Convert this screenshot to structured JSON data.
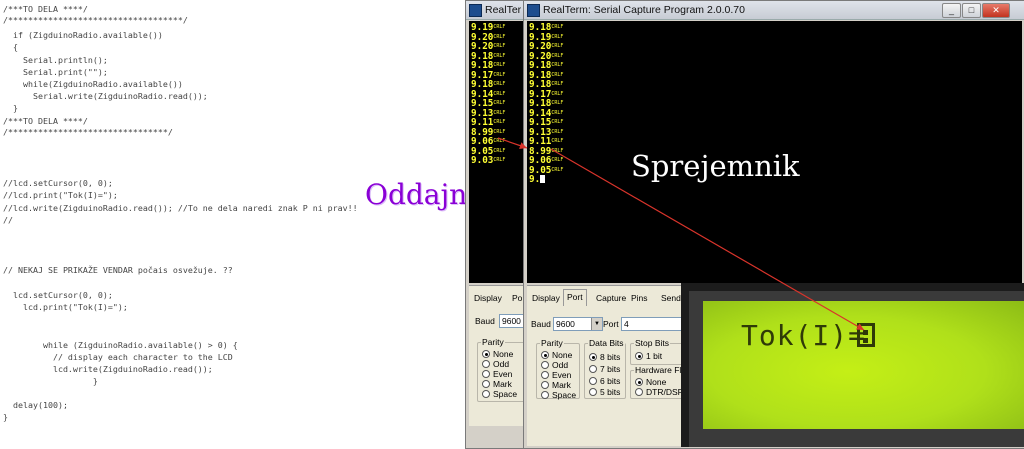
{
  "code": {
    "lines": [
      "/***TO DELA ****/",
      "/***********************************/",
      "  if (ZigduinoRadio.available())",
      "  {",
      "    Serial.println();",
      "    Serial.print(\"\");",
      "    while(ZigduinoRadio.available())",
      "      Serial.write(ZigduinoRadio.read());",
      "  }",
      "/***TO DELA ****/",
      "/********************************/",
      "//lcd.setCursor(0, 0);",
      "//lcd.print(\"Tok(I)=\");",
      "//lcd.write(ZigduinoRadio.read()); //To ne dela naredi znak P ni prav!!",
      "//",
      "// NEKAJ SE PRIKAŽE VENDAR počais osvežuje. ??",
      "  lcd.setCursor(0, 0);",
      "    lcd.print(\"Tok(I)=\");",
      "        while (ZigduinoRadio.available() > 0) {",
      "          // display each character to the LCD",
      "          lcd.write(ZigduinoRadio.read());",
      "                  }",
      "  delay(100);",
      "}"
    ]
  },
  "labels": {
    "transmitter": "Oddajnik",
    "receiver": "Sprejemnik"
  },
  "window_back": {
    "title": "RealTer",
    "terminal_lines": [
      "9.19",
      "9.20",
      "9.20",
      "9.18",
      "9.18",
      "9.17",
      "9.18",
      "9.14",
      "9.15",
      "9.13",
      "9.11",
      "8.99",
      "9.06",
      "9.05",
      "9.03"
    ],
    "line_end": "CRLF",
    "tabs": [
      "Display",
      "Po"
    ],
    "baud_label": "Baud",
    "baud_value": "9600",
    "parity_label": "Parity",
    "parity_options": [
      "None",
      "Odd",
      "Even",
      "Mark",
      "Space"
    ]
  },
  "window_front": {
    "title": "RealTerm: Serial Capture Program 2.0.0.70",
    "terminal_lines": [
      "9.18",
      "9.19",
      "9.20",
      "9.20",
      "9.18",
      "9.18",
      "9.18",
      "9.17",
      "9.18",
      "9.14",
      "9.15",
      "9.13",
      "9.11",
      "8.99",
      "9.06",
      "9.05"
    ],
    "last_line": "9.",
    "line_end": "CRLF",
    "tabs": [
      "Display",
      "Port",
      "Capture",
      "Pins",
      "Send"
    ],
    "baud_label": "Baud",
    "baud_value": "9600",
    "port_label": "Port",
    "port_value": "4",
    "parity_label": "Parity",
    "parity_options": [
      "None",
      "Odd",
      "Even",
      "Mark",
      "Space"
    ],
    "databits_label": "Data Bits",
    "databits_options": [
      "8 bits",
      "7 bits",
      "6 bits",
      "5 bits"
    ],
    "stopbits_label": "Stop Bits",
    "stopbits_value": "1 bit",
    "flow_label": "Hardware Flow",
    "flow_options": [
      "None",
      "DTR/DSR"
    ],
    "buttons": {
      "minimize": "_",
      "maximize": "□",
      "close": "✕"
    }
  },
  "lcd": {
    "text": "Tok(I)="
  },
  "colors": {
    "terminal_text": "#ffff33",
    "label_transmitter": "#8a00d6",
    "lcd_background": "#b0e01a",
    "arrow": "#d9342b"
  }
}
